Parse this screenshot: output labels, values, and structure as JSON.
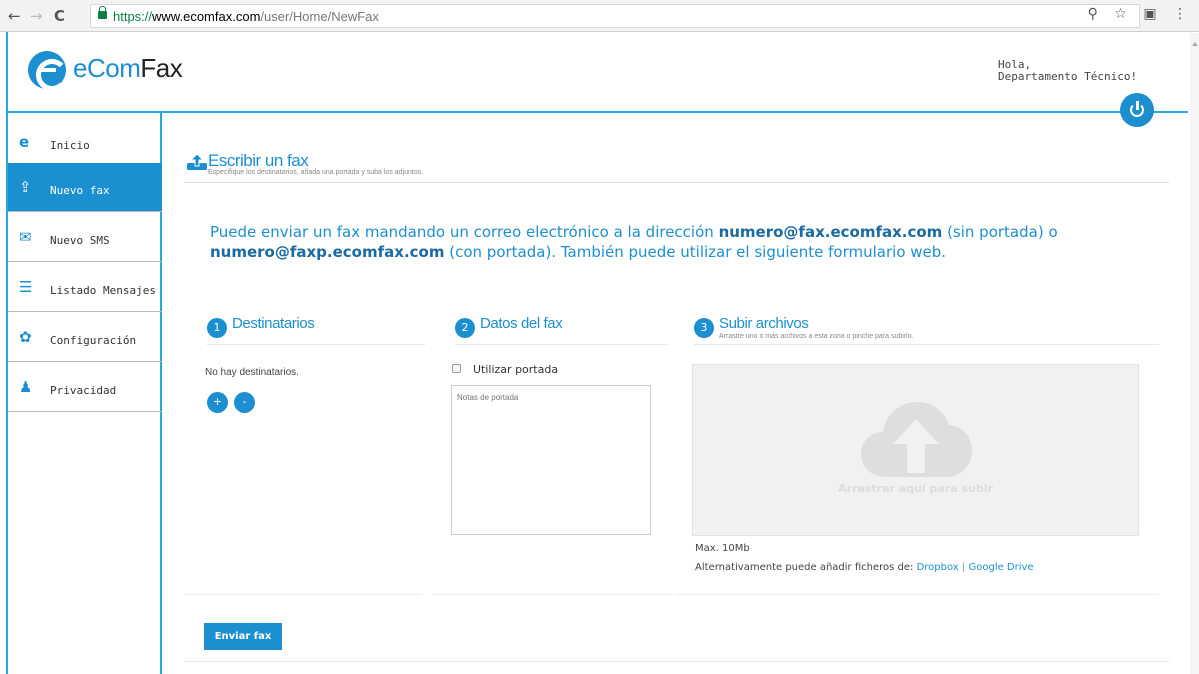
{
  "browser": {
    "url_scheme": "https://",
    "url_host": "www.ecomfax.com",
    "url_path": "/user/Home/NewFax",
    "back_icon": "←",
    "forward_icon": "→",
    "reload_icon": "C",
    "zoom_icon": "⚲",
    "star_icon": "☆",
    "ext_icon": "▣",
    "menu_icon": "⋮"
  },
  "header": {
    "logo_part1": "eCom",
    "logo_part2": "Fax",
    "greeting_line1": "Hola,",
    "greeting_line2": "Departamento Técnico!"
  },
  "sidebar": {
    "items": [
      {
        "label": "Inicio",
        "icon": "e"
      },
      {
        "label": "Nuevo fax",
        "icon": "⇪"
      },
      {
        "label": "Nuevo SMS",
        "icon": "✉"
      },
      {
        "label": "Listado Mensajes",
        "icon": "☰"
      },
      {
        "label": "Configuración",
        "icon": "✿"
      },
      {
        "label": "Privacidad",
        "icon": "♟"
      }
    ]
  },
  "main": {
    "title": "Escribir un fax",
    "subtitle": "Especifique los destinatarios, añada una portada y suba los adjuntos.",
    "info_part1": "Puede enviar un fax mandando un correo electrónico a la dirección ",
    "info_email1": "numero@fax.ecomfax.com",
    "info_part2": " (sin portada) o ",
    "info_email2": "numero@faxp.ecomfax.com",
    "info_part3": " (con portada). También puede utilizar el siguiente formulario web."
  },
  "destinatarios": {
    "number": "1",
    "title": "Destinatarios",
    "empty_text": "No hay destinatarios.",
    "add_label": "+",
    "remove_label": "-"
  },
  "datos": {
    "number": "2",
    "title": "Datos del fax",
    "use_cover_label": "Utilizar portada",
    "notes_placeholder": "Notas de portada"
  },
  "subir": {
    "number": "3",
    "title": "Subir archivos",
    "subtitle": "Arrastre uno o más archivos a esta zona o pinche para subirlo.",
    "drop_text": "Arrastrar aquí para subir",
    "max_size": "Max. 10Mb",
    "alt_prefix": "Alternativamente puede añadir ficheros de: ",
    "dropbox": "Dropbox",
    "separator": "|",
    "gdrive": "Google Drive"
  },
  "actions": {
    "send_label": "Enviar fax"
  },
  "colors": {
    "accent": "#1c8fd1",
    "border": "#2aa7df"
  }
}
